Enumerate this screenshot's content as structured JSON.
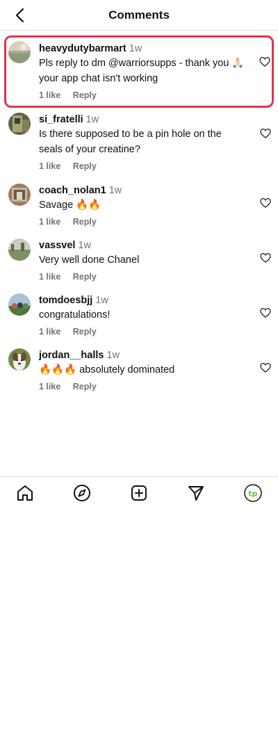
{
  "header": {
    "title": "Comments"
  },
  "comments": [
    {
      "username": "heavydutybarmart",
      "time": "1w",
      "text": "Pls reply to dm @warriorsupps - thank you 🙏🏻 your app chat isn't working",
      "likes": "1 like",
      "reply": "Reply",
      "avatar_color": "#c9b89a"
    },
    {
      "username": "si_fratelli",
      "time": "1w",
      "text": "Is there supposed to be a pin hole on the seals of your creatine?",
      "likes": "1 like",
      "reply": "Reply",
      "avatar_color": "#6b6a4a"
    },
    {
      "username": "coach_nolan1",
      "time": "1w",
      "text": "Savage 🔥🔥",
      "likes": "1 like",
      "reply": "Reply",
      "avatar_color": "#a7896a"
    },
    {
      "username": "vassvel",
      "time": "1w",
      "text": "Very well done Chanel",
      "likes": "1 like",
      "reply": "Reply",
      "avatar_color": "#9aa191"
    },
    {
      "username": "tomdoesbjj",
      "time": "1w",
      "text": "congratulations!",
      "likes": "1 like",
      "reply": "Reply",
      "avatar_color": "#5f8a55"
    },
    {
      "username": "jordan__halls",
      "time": "1w",
      "text": "🔥🔥🔥 absolutely dominated",
      "likes": "1 like",
      "reply": "Reply",
      "avatar_color": "#7f9a55"
    }
  ],
  "nav": {
    "items": [
      "home-icon",
      "explore-icon",
      "create-icon",
      "direct-icon",
      "profile-avatar"
    ],
    "profile_initials": "tp",
    "accent": "#6bbf3a"
  },
  "colors": {
    "highlight": "#e53248",
    "muted": "#737373"
  }
}
